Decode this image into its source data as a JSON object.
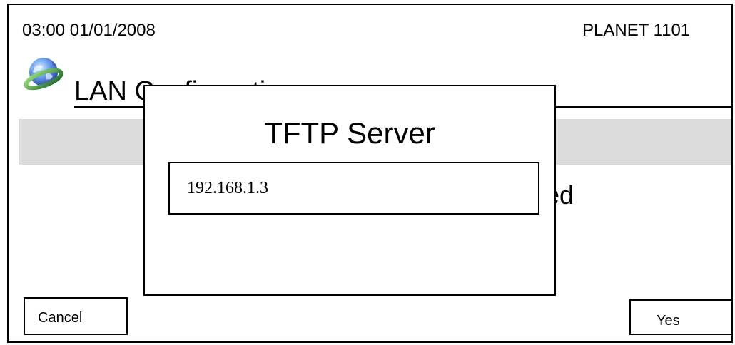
{
  "header": {
    "datetime": "03:00 01/01/2008",
    "device_name": "PLANET 1101"
  },
  "page": {
    "title": "LAN Configuration",
    "title_icon": "globe-icon",
    "status_fragment": "ed"
  },
  "dialog": {
    "title": "TFTP Server",
    "input_value": "192.168.1.3"
  },
  "buttons": {
    "cancel_label": "Cancel",
    "yes_label": "Yes"
  },
  "colors": {
    "band": "#dcdcdc",
    "globe_ring": "#2e8b57",
    "globe_sphere": "#3a6fd8"
  }
}
